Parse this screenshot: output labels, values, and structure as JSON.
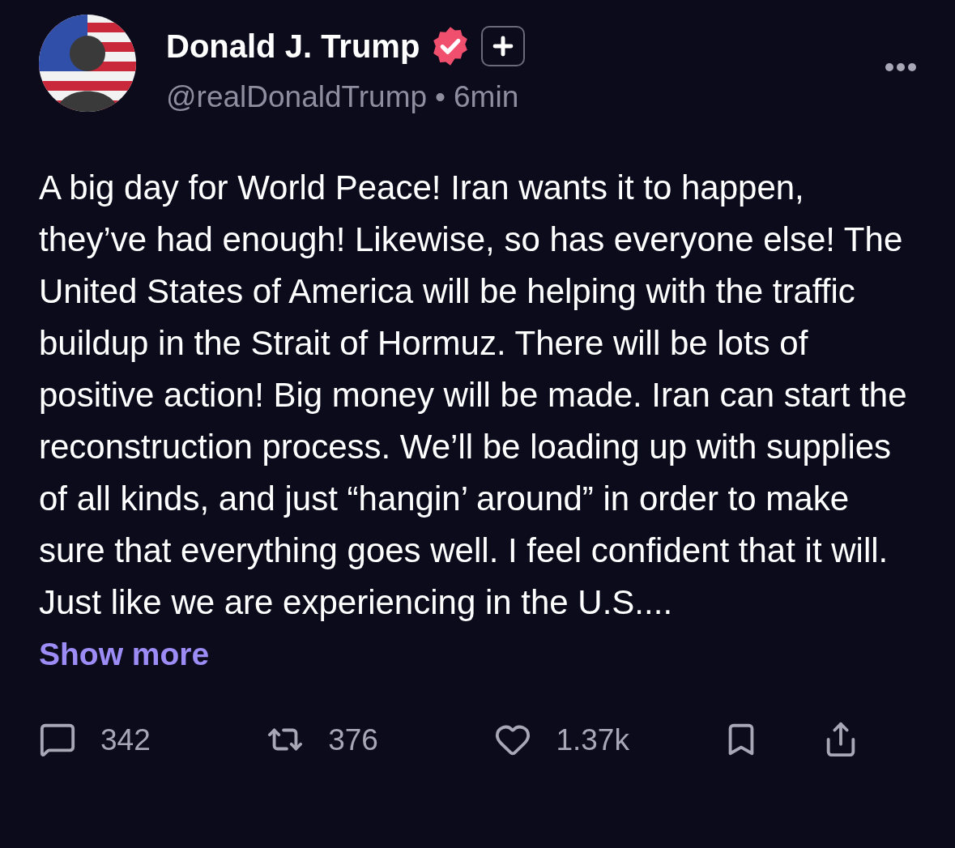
{
  "post": {
    "author": {
      "name": "Donald J. Trump",
      "verified": true,
      "handle": "@realDonaldTrump",
      "separator": "•",
      "time": "6min"
    },
    "text": "A big day for World Peace! Iran wants it to happen, they’ve had enough! Likewise, so has everyone else! The United States of America will be helping with the traffic buildup in the Strait of Hormuz. There will be lots of positive action! Big money will be made. Iran can start the reconstruction process. We’ll be loading up with supplies of all kinds, and just “hangin’ around” in order to make sure that everything goes well. I feel confident that it will. Just like we are experiencing in the U.S....",
    "show_more": "Show more",
    "actions": [
      {
        "kind": "reply",
        "count": "342"
      },
      {
        "kind": "repost",
        "count": "376"
      },
      {
        "kind": "like",
        "count": "1.37k"
      },
      {
        "kind": "bookmark"
      },
      {
        "kind": "share"
      }
    ]
  }
}
